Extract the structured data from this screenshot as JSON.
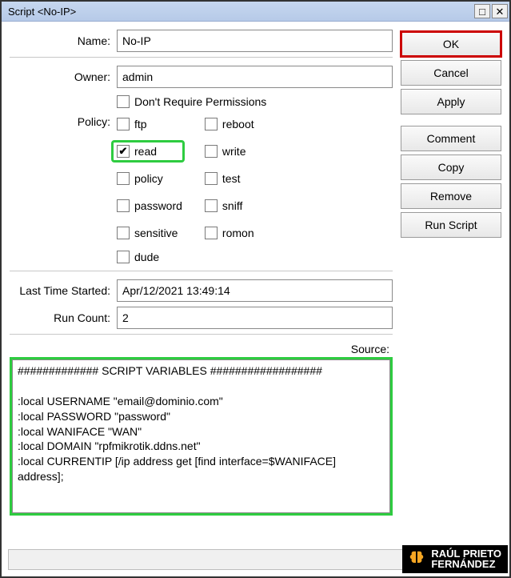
{
  "window": {
    "title": "Script <No-IP>",
    "minimize_glyph": "□",
    "close_glyph": "✕"
  },
  "form": {
    "name_label": "Name:",
    "name_value": "No-IP",
    "owner_label": "Owner:",
    "owner_value": "admin",
    "dont_require_perms_label": "Don't Require Permissions",
    "policy_label": "Policy:",
    "policy": {
      "ftp": "ftp",
      "read": "read",
      "policy": "policy",
      "password": "password",
      "sensitive": "sensitive",
      "reboot": "reboot",
      "write": "write",
      "test": "test",
      "sniff": "sniff",
      "romon": "romon",
      "dude": "dude"
    },
    "last_started_label": "Last Time Started:",
    "last_started_value": "Apr/12/2021 13:49:14",
    "run_count_label": "Run Count:",
    "run_count_value": "2",
    "source_label": "Source:",
    "source_value": "############# SCRIPT VARIABLES ##################\n\n:local USERNAME \"email@dominio.com\"\n:local PASSWORD \"password\"\n:local WANIFACE \"WAN\"\n:local DOMAIN \"rpfmikrotik.ddns.net\"\n:local CURRENTIP [/ip address get [find interface=$WANIFACE] address];"
  },
  "buttons": {
    "ok": "OK",
    "cancel": "Cancel",
    "apply": "Apply",
    "comment": "Comment",
    "copy": "Copy",
    "remove": "Remove",
    "run_script": "Run Script"
  },
  "watermark": {
    "line1": "RAÚL PRIETO",
    "line2": "FERNÁNDEZ"
  },
  "checkmark": "✔"
}
